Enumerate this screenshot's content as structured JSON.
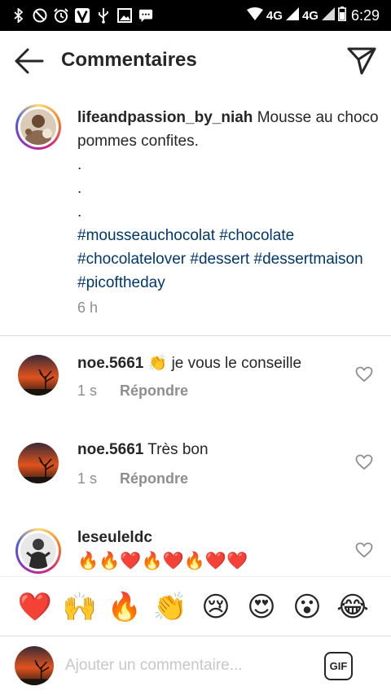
{
  "status_bar": {
    "icons_left": [
      "bluetooth-icon",
      "do-not-disturb-icon",
      "alarm-icon",
      "vlc-icon",
      "usb-icon",
      "image-icon",
      "message-icon"
    ],
    "network_1": "4G",
    "network_2": "4G",
    "time": "6:29"
  },
  "header": {
    "title": "Commentaires"
  },
  "caption": {
    "username": "lifeandpassion_by_niah",
    "text": "Mousse au choco pommes confites.",
    "dots": [
      ".",
      ".",
      "."
    ],
    "hashtags": [
      "#mousseauchocolat",
      "#chocolate",
      "#chocolatelover",
      "#dessert",
      "#dessertmaison",
      "#picoftheday"
    ],
    "time": "6 h"
  },
  "comments": [
    {
      "username": "noe.5661",
      "emoji": "👏",
      "text": "je vous le conseille",
      "time": "1 s",
      "reply": "Répondre"
    },
    {
      "username": "noe.5661",
      "emoji": "",
      "text": "Très bon",
      "time": "1 s",
      "reply": "Répondre"
    },
    {
      "username": "leseuleldc",
      "emoji": "",
      "text": "🔥🔥❤️🔥❤️🔥❤️❤️",
      "time": "",
      "reply": ""
    }
  ],
  "emoji_bar": [
    "❤️",
    "🙌",
    "🔥",
    "👏",
    "😢",
    "😍",
    "😮",
    "😂"
  ],
  "composer": {
    "placeholder": "Ajouter un commentaire...",
    "gif_label": "GIF"
  },
  "colors": {
    "hashtag": "#00376b",
    "secondary_text": "#8e8e8e",
    "primary_text": "#262626",
    "divider": "#dbdbdb"
  }
}
